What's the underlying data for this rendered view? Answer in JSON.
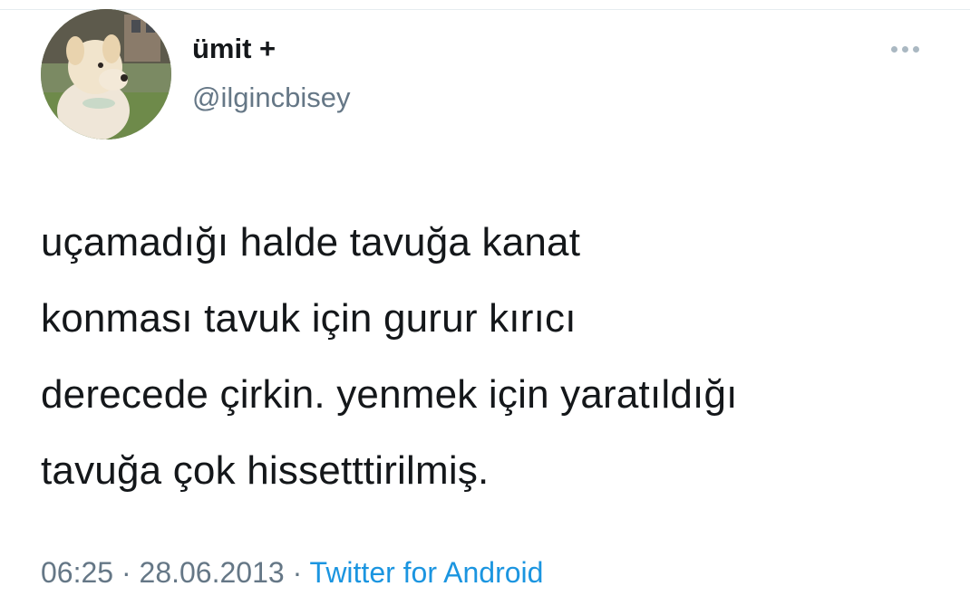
{
  "user": {
    "display_name": "ümit +",
    "handle": "@ilgincbisey",
    "avatar": "dog-avatar"
  },
  "tweet": {
    "text_lines": [
      "uçamadığı halde tavuğa kanat",
      "konması tavuk için gurur kırıcı",
      "derecede çirkin. yenmek için yaratıldığı",
      "tavuğa çok hissetttirilmiş."
    ],
    "time": "06:25",
    "date": "28.06.2013",
    "separator": "·",
    "source": "Twitter for Android"
  },
  "icons": {
    "more": "more-options-icon"
  },
  "colors": {
    "text": "#14171a",
    "muted": "#657786",
    "link": "#1b95e0"
  }
}
